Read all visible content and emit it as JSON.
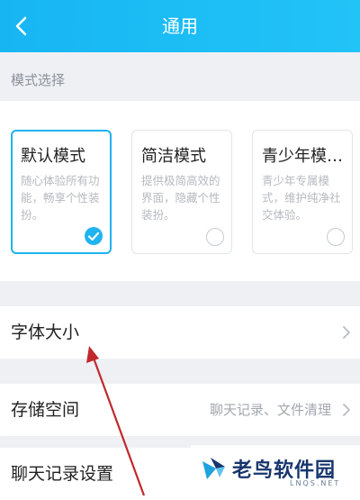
{
  "header": {
    "title": "通用",
    "back_icon": "chevron-left-icon"
  },
  "mode_section": {
    "label": "模式选择",
    "cards": [
      {
        "title": "默认模式",
        "desc": "随心体验所有功能，畅享个性装扮。",
        "selected": true
      },
      {
        "title": "简洁模式",
        "desc": "提供极简高效的界面，隐藏个性装扮。",
        "selected": false
      },
      {
        "title": "青少年模…",
        "desc": "青少年专属模式，维护纯净社交体验。",
        "selected": false
      }
    ]
  },
  "settings": [
    {
      "label": "字体大小",
      "value": ""
    },
    {
      "label": "存储空间",
      "value": "聊天记录、文件清理"
    },
    {
      "label": "聊天记录设置",
      "value": ""
    }
  ],
  "watermark": {
    "text": "老鸟软件园",
    "sub": "LNQS.NET"
  },
  "colors": {
    "accent": "#1fb3ef",
    "arrow": "#c0292b"
  }
}
